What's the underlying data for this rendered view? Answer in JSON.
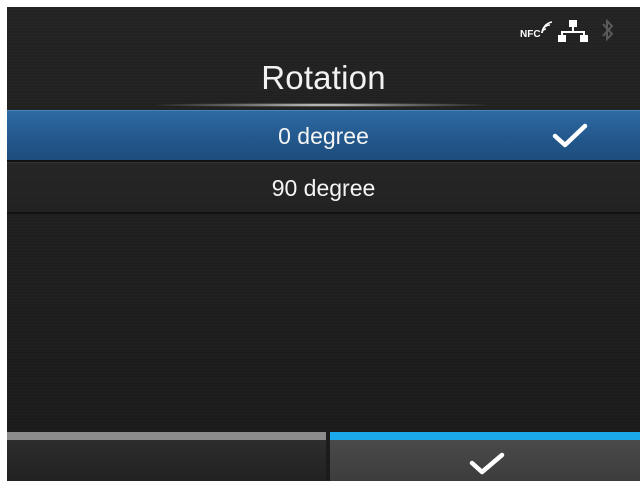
{
  "status": {
    "icons": [
      "nfc-icon",
      "network-icon",
      "bluetooth-icon"
    ],
    "nfc_text": "NFC"
  },
  "screen": {
    "title": "Rotation"
  },
  "options": [
    {
      "label": "0 degree",
      "selected": true
    },
    {
      "label": "90 degree",
      "selected": false
    }
  ],
  "softkeys": {
    "left": {
      "label": "",
      "icon": ""
    },
    "right": {
      "label": "",
      "icon": "check-icon"
    }
  },
  "colors": {
    "selected_row": "#23588d",
    "accent": "#1aa9ea",
    "background": "#1e1e1e",
    "left_key_bar": "#8c8c8c"
  }
}
